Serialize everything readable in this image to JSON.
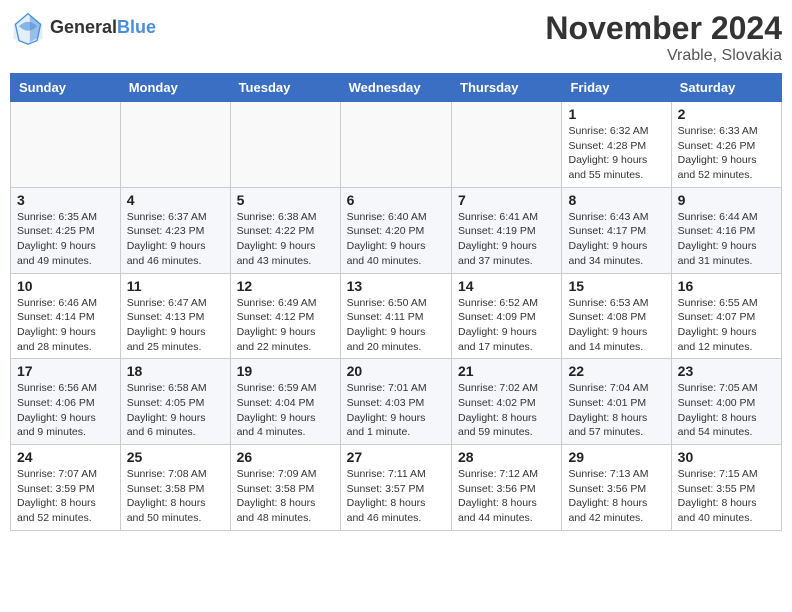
{
  "header": {
    "logo_line1": "General",
    "logo_line2": "Blue",
    "month_title": "November 2024",
    "location": "Vrable, Slovakia"
  },
  "weekdays": [
    "Sunday",
    "Monday",
    "Tuesday",
    "Wednesday",
    "Thursday",
    "Friday",
    "Saturday"
  ],
  "weeks": [
    [
      {
        "day": "",
        "info": ""
      },
      {
        "day": "",
        "info": ""
      },
      {
        "day": "",
        "info": ""
      },
      {
        "day": "",
        "info": ""
      },
      {
        "day": "",
        "info": ""
      },
      {
        "day": "1",
        "info": "Sunrise: 6:32 AM\nSunset: 4:28 PM\nDaylight: 9 hours and 55 minutes."
      },
      {
        "day": "2",
        "info": "Sunrise: 6:33 AM\nSunset: 4:26 PM\nDaylight: 9 hours and 52 minutes."
      }
    ],
    [
      {
        "day": "3",
        "info": "Sunrise: 6:35 AM\nSunset: 4:25 PM\nDaylight: 9 hours and 49 minutes."
      },
      {
        "day": "4",
        "info": "Sunrise: 6:37 AM\nSunset: 4:23 PM\nDaylight: 9 hours and 46 minutes."
      },
      {
        "day": "5",
        "info": "Sunrise: 6:38 AM\nSunset: 4:22 PM\nDaylight: 9 hours and 43 minutes."
      },
      {
        "day": "6",
        "info": "Sunrise: 6:40 AM\nSunset: 4:20 PM\nDaylight: 9 hours and 40 minutes."
      },
      {
        "day": "7",
        "info": "Sunrise: 6:41 AM\nSunset: 4:19 PM\nDaylight: 9 hours and 37 minutes."
      },
      {
        "day": "8",
        "info": "Sunrise: 6:43 AM\nSunset: 4:17 PM\nDaylight: 9 hours and 34 minutes."
      },
      {
        "day": "9",
        "info": "Sunrise: 6:44 AM\nSunset: 4:16 PM\nDaylight: 9 hours and 31 minutes."
      }
    ],
    [
      {
        "day": "10",
        "info": "Sunrise: 6:46 AM\nSunset: 4:14 PM\nDaylight: 9 hours and 28 minutes."
      },
      {
        "day": "11",
        "info": "Sunrise: 6:47 AM\nSunset: 4:13 PM\nDaylight: 9 hours and 25 minutes."
      },
      {
        "day": "12",
        "info": "Sunrise: 6:49 AM\nSunset: 4:12 PM\nDaylight: 9 hours and 22 minutes."
      },
      {
        "day": "13",
        "info": "Sunrise: 6:50 AM\nSunset: 4:11 PM\nDaylight: 9 hours and 20 minutes."
      },
      {
        "day": "14",
        "info": "Sunrise: 6:52 AM\nSunset: 4:09 PM\nDaylight: 9 hours and 17 minutes."
      },
      {
        "day": "15",
        "info": "Sunrise: 6:53 AM\nSunset: 4:08 PM\nDaylight: 9 hours and 14 minutes."
      },
      {
        "day": "16",
        "info": "Sunrise: 6:55 AM\nSunset: 4:07 PM\nDaylight: 9 hours and 12 minutes."
      }
    ],
    [
      {
        "day": "17",
        "info": "Sunrise: 6:56 AM\nSunset: 4:06 PM\nDaylight: 9 hours and 9 minutes."
      },
      {
        "day": "18",
        "info": "Sunrise: 6:58 AM\nSunset: 4:05 PM\nDaylight: 9 hours and 6 minutes."
      },
      {
        "day": "19",
        "info": "Sunrise: 6:59 AM\nSunset: 4:04 PM\nDaylight: 9 hours and 4 minutes."
      },
      {
        "day": "20",
        "info": "Sunrise: 7:01 AM\nSunset: 4:03 PM\nDaylight: 9 hours and 1 minute."
      },
      {
        "day": "21",
        "info": "Sunrise: 7:02 AM\nSunset: 4:02 PM\nDaylight: 8 hours and 59 minutes."
      },
      {
        "day": "22",
        "info": "Sunrise: 7:04 AM\nSunset: 4:01 PM\nDaylight: 8 hours and 57 minutes."
      },
      {
        "day": "23",
        "info": "Sunrise: 7:05 AM\nSunset: 4:00 PM\nDaylight: 8 hours and 54 minutes."
      }
    ],
    [
      {
        "day": "24",
        "info": "Sunrise: 7:07 AM\nSunset: 3:59 PM\nDaylight: 8 hours and 52 minutes."
      },
      {
        "day": "25",
        "info": "Sunrise: 7:08 AM\nSunset: 3:58 PM\nDaylight: 8 hours and 50 minutes."
      },
      {
        "day": "26",
        "info": "Sunrise: 7:09 AM\nSunset: 3:58 PM\nDaylight: 8 hours and 48 minutes."
      },
      {
        "day": "27",
        "info": "Sunrise: 7:11 AM\nSunset: 3:57 PM\nDaylight: 8 hours and 46 minutes."
      },
      {
        "day": "28",
        "info": "Sunrise: 7:12 AM\nSunset: 3:56 PM\nDaylight: 8 hours and 44 minutes."
      },
      {
        "day": "29",
        "info": "Sunrise: 7:13 AM\nSunset: 3:56 PM\nDaylight: 8 hours and 42 minutes."
      },
      {
        "day": "30",
        "info": "Sunrise: 7:15 AM\nSunset: 3:55 PM\nDaylight: 8 hours and 40 minutes."
      }
    ]
  ]
}
